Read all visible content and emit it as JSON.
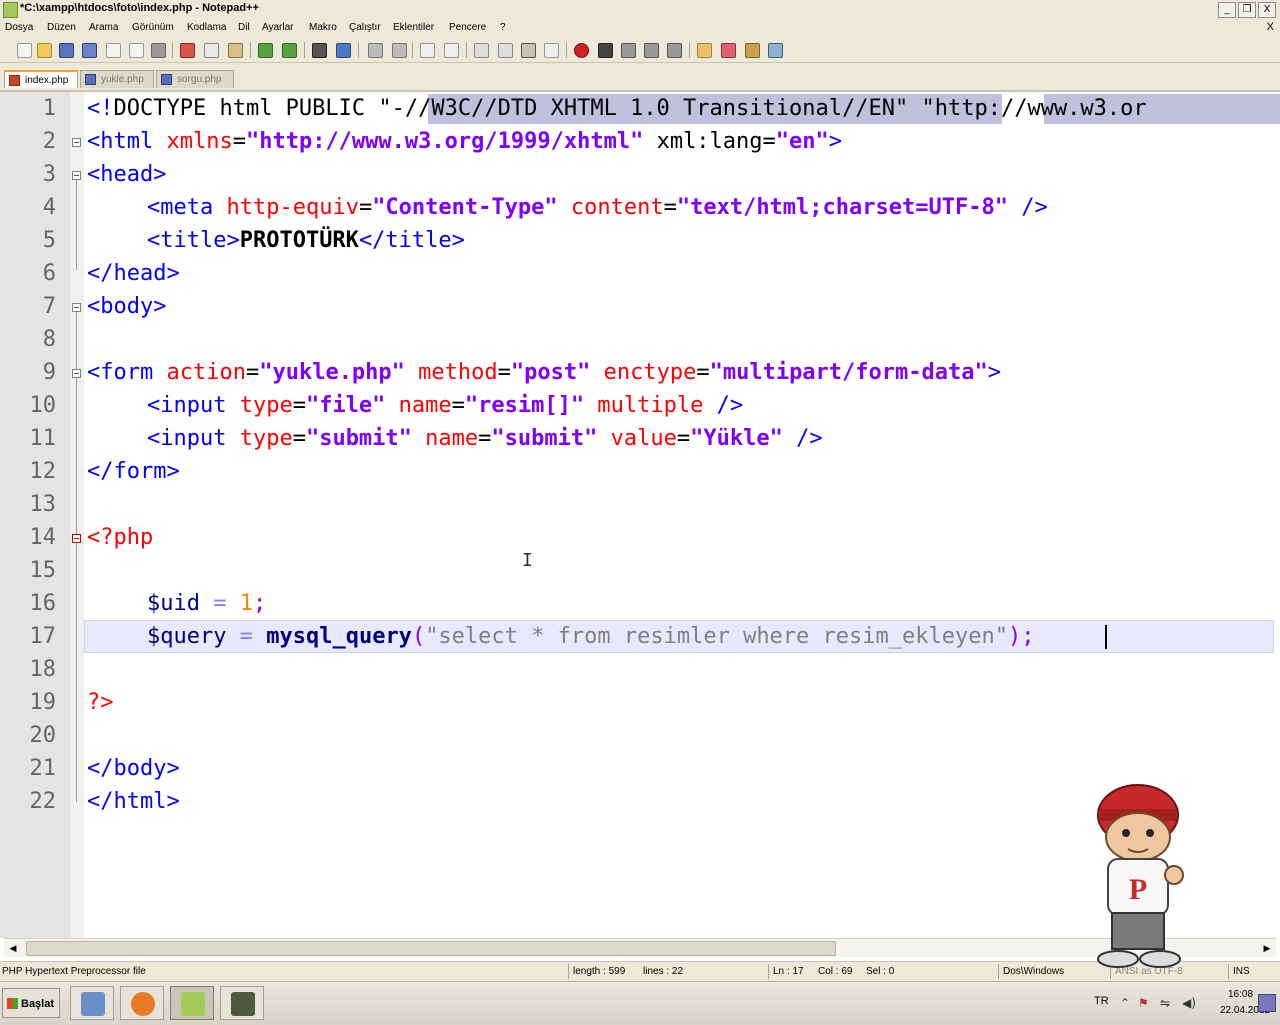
{
  "window": {
    "title": "*C:\\xampp\\htdocs\\foto\\index.php - Notepad++",
    "controls": [
      "_",
      "❐",
      "X"
    ]
  },
  "menu": {
    "items": [
      "Dosya",
      "Düzen",
      "Arama",
      "Görünüm",
      "Kodlama",
      "Dil",
      "Ayarlar",
      "Makro",
      "Çalıştır",
      "Eklentiler",
      "Pencere",
      "?"
    ],
    "doc_close": "X"
  },
  "tabs": [
    {
      "label": "index.php",
      "active": true
    },
    {
      "label": "yukle.php",
      "active": false
    },
    {
      "label": "sorgu.php",
      "active": false
    }
  ],
  "editor": {
    "line_numbers": [
      "1",
      "2",
      "3",
      "4",
      "5",
      "6",
      "7",
      "8",
      "9",
      "10",
      "11",
      "12",
      "13",
      "14",
      "15",
      "16",
      "17",
      "18",
      "19",
      "20",
      "21",
      "22"
    ],
    "current_line": 17,
    "line1": {
      "a": "<!",
      "b": "DOCTYPE html PUBLIC ",
      "c": "\"",
      "d": "-//W3C//DTD XHTML 1.0 Transitional//EN",
      "e": "\" \"",
      "f": "http://www.w3.or"
    },
    "line2": {
      "tag_open": "<html ",
      "attr1": "xmlns",
      "eq1": "=",
      "val1": "\"http://www.w3.org/1999/xhtml\"",
      "attr2": " xml:lang",
      "eq2": "=",
      "val2": "\"en\"",
      "tag_close": ">"
    },
    "line3": {
      "tag": "<head>"
    },
    "line4": {
      "tag_open": "<meta ",
      "attr1": "http-equiv",
      "eq1": "=",
      "val1": "\"Content-Type\"",
      "attr2": " content",
      "eq2": "=",
      "val2": "\"text/html;charset=UTF-8\"",
      "tag_close": " />"
    },
    "line5": {
      "tag_open": "<title>",
      "text": "PROTOTÜRK",
      "tag_close": "</title>"
    },
    "line6": {
      "tag": "</head>"
    },
    "line7": {
      "tag": "<body>"
    },
    "line9": {
      "tag_open": "<form ",
      "attr1": "action",
      "eq1": "=",
      "val1": "\"yukle.php\"",
      "attr2": " method",
      "eq2": "=",
      "val2": "\"post\"",
      "attr3": " enctype",
      "eq3": "=",
      "val3": "\"multipart/form-data\"",
      "tag_close": ">"
    },
    "line10": {
      "tag_open": "<input ",
      "attr1": "type",
      "eq1": "=",
      "val1": "\"file\"",
      "attr2": " name",
      "eq2": "=",
      "val2": "\"resim[]\"",
      "attr3": " multiple",
      "tag_close": " />"
    },
    "line11": {
      "tag_open": "<input ",
      "attr1": "type",
      "eq1": "=",
      "val1": "\"submit\"",
      "attr2": " name",
      "eq2": "=",
      "val2": "\"submit\"",
      "attr3": " value",
      "eq3": "=",
      "val3": "\"Yükle\"",
      "tag_close": " />"
    },
    "line12": {
      "tag": "</form>"
    },
    "line14": {
      "php_open": "<?php"
    },
    "line16": {
      "var": "$uid",
      "op": " = ",
      "num": "1",
      "punc": ";"
    },
    "line17": {
      "var": "$query",
      "op": " = ",
      "func": "mysql_query",
      "paren": "(",
      "str_a": "\"select * from resimler where resim_ekleyen",
      "str_b": "\"",
      "close": ");"
    },
    "line19": {
      "php_close": "?>"
    },
    "line21": {
      "tag": "</body>"
    },
    "line22": {
      "tag": "</html>"
    }
  },
  "statusbar": {
    "file_type": "PHP Hypertext Preprocessor file",
    "length": "length : 599",
    "lines": "lines : 22",
    "ln": "Ln : 17",
    "col": "Col : 69",
    "sel": "Sel : 0",
    "eol": "Dos\\Windows",
    "encoding": "ANSI as UTF-8",
    "mode": "INS"
  },
  "taskbar": {
    "start_label": "Başlat",
    "language": "TR",
    "time": "16:08",
    "date": "22.04.2012"
  },
  "colors": {
    "tag": "#0000ff",
    "attribute": "#ff0000",
    "attribute_value": "#8000ff",
    "php_delimiter": "#ff0000",
    "php_string": "#808080",
    "current_line": "#e8e8ff"
  }
}
